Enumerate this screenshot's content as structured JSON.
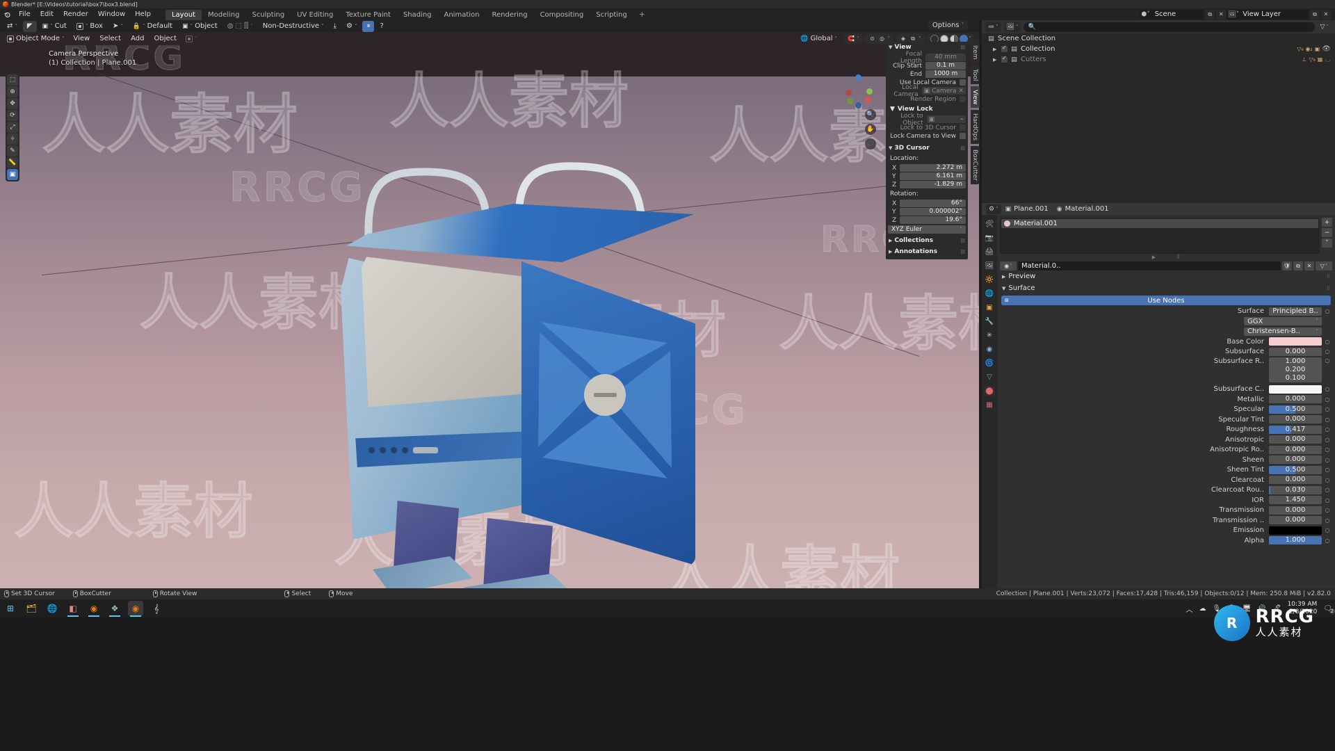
{
  "window": {
    "title": "Blender* [E:\\Videos\\tutorial\\box7\\box3.blend]",
    "icon": "blender-icon"
  },
  "topbar": {
    "logo": "blender-logo",
    "menus": [
      "File",
      "Edit",
      "Render",
      "Window",
      "Help"
    ],
    "workspaces": [
      {
        "label": "Layout",
        "active": true
      },
      {
        "label": "Modeling",
        "active": false
      },
      {
        "label": "Sculpting",
        "active": false
      },
      {
        "label": "UV Editing",
        "active": false
      },
      {
        "label": "Texture Paint",
        "active": false
      },
      {
        "label": "Shading",
        "active": false
      },
      {
        "label": "Animation",
        "active": false
      },
      {
        "label": "Rendering",
        "active": false
      },
      {
        "label": "Compositing",
        "active": false
      },
      {
        "label": "Scripting",
        "active": false
      }
    ],
    "add_workspace": "+",
    "scene_label": "Scene",
    "viewlayer_label": "View Layer"
  },
  "addon_toolbar": {
    "cut_label": "Cut",
    "shape_label": "Box",
    "mode_label": "Default",
    "target_label": "Object",
    "behavior_label": "Non-Destructive"
  },
  "viewport": {
    "mode": "Object Mode",
    "menus": [
      "View",
      "Select",
      "Add",
      "Object"
    ],
    "orientation": "Global",
    "options_label": "Options",
    "overlay_label": "Camera Perspective",
    "overlay_label2": "(1) Collection | Plane.001",
    "gizmo_axes": [
      "X",
      "Y",
      "Z"
    ]
  },
  "npanel": {
    "tabs": [
      {
        "label": "Item",
        "active": false
      },
      {
        "label": "Tool",
        "active": false
      },
      {
        "label": "View",
        "active": true
      },
      {
        "label": "HardOps",
        "active": false
      },
      {
        "label": "BoxCutter",
        "active": false
      }
    ],
    "view_section": {
      "title": "View",
      "rows": [
        {
          "label": "Focal Length",
          "value": "40 mm",
          "dim": true
        },
        {
          "label": "Clip Start",
          "value": "0.1 m",
          "dim": false
        },
        {
          "label": "End",
          "value": "1000 m",
          "dim": false
        }
      ],
      "use_local_camera": "Use Local Camera",
      "local_camera_label": "Local Camera",
      "local_camera_value": "Camera",
      "render_region": "Render Region"
    },
    "view_lock": {
      "title": "View Lock",
      "lock_to_object": "Lock to Object",
      "lock_to_3d_cursor": "Lock to 3D Cursor",
      "lock_camera_to_view": "Lock Camera to View"
    },
    "cursor3d": {
      "title": "3D Cursor",
      "location_label": "Location:",
      "location": [
        {
          "axis": "X",
          "value": "2.272 m"
        },
        {
          "axis": "Y",
          "value": "6.161 m"
        },
        {
          "axis": "Z",
          "value": "-1.829 m"
        }
      ],
      "rotation_label": "Rotation:",
      "rotation": [
        {
          "axis": "X",
          "value": "66°"
        },
        {
          "axis": "Y",
          "value": "0.000002°"
        },
        {
          "axis": "Z",
          "value": "19.6°"
        }
      ],
      "euler_mode": "XYZ Euler"
    },
    "collapsed": [
      {
        "title": "Collections"
      },
      {
        "title": "Annotations"
      }
    ]
  },
  "outliner": {
    "display_mode": "view-layer-icon",
    "filter_icon": "filter-icon",
    "search_placeholder": "",
    "rows": [
      {
        "label": "Scene Collection",
        "indent": 0,
        "icon": "collection-icon",
        "checkbox": false,
        "expandable": false,
        "dim": false,
        "badges": []
      },
      {
        "label": "Collection",
        "indent": 1,
        "icon": "collection-icon",
        "checkbox": true,
        "expandable": true,
        "dim": false,
        "badges": [
          "mesh-9",
          "material-2",
          "object"
        ]
      },
      {
        "label": "Cutters",
        "indent": 1,
        "icon": "collection-icon",
        "checkbox": true,
        "expandable": true,
        "dim": true,
        "badges": [
          "empty",
          "mesh-9",
          "grid"
        ]
      }
    ]
  },
  "properties": {
    "breadcrumb": [
      {
        "label": "Plane.001",
        "icon": "object-icon"
      },
      {
        "label": "Material.001",
        "icon": "material-icon"
      }
    ],
    "tabs": [
      {
        "name": "tool-tab",
        "icon": "🛠",
        "color": "#b9b9b9",
        "active": false
      },
      {
        "name": "render-tab",
        "icon": "📷",
        "color": "#c9c9c9",
        "active": false
      },
      {
        "name": "output-tab",
        "icon": "🖨",
        "color": "#c9c9c9",
        "active": false
      },
      {
        "name": "viewlayer-tab",
        "icon": "🖼",
        "color": "#c9c9c9",
        "active": false
      },
      {
        "name": "scene-tab",
        "icon": "🔆",
        "color": "#d4b37a",
        "active": false
      },
      {
        "name": "world-tab",
        "icon": "🌐",
        "color": "#d96a6a",
        "active": false
      },
      {
        "name": "object-tab",
        "icon": "▣",
        "color": "#e8a33d",
        "active": false
      },
      {
        "name": "modifier-tab",
        "icon": "🔧",
        "color": "#5b9fe0",
        "active": false
      },
      {
        "name": "particles-tab",
        "icon": "✳",
        "color": "#a7c6e8",
        "active": false
      },
      {
        "name": "physics-tab",
        "icon": "◉",
        "color": "#7fb2e8",
        "active": false
      },
      {
        "name": "constraints-tab",
        "icon": "🌀",
        "color": "#7fb2e8",
        "active": false
      },
      {
        "name": "data-tab",
        "icon": "▽",
        "color": "#4fbf8f",
        "active": false
      },
      {
        "name": "material-tab",
        "icon": "⬤",
        "color": "#e06767",
        "active": true
      },
      {
        "name": "texture-tab",
        "icon": "▦",
        "color": "#d16a6a",
        "active": false
      }
    ],
    "material_slot": "Material.001",
    "material_id_name": "Material.0..",
    "preview_label": "Preview",
    "surface_label": "Surface",
    "use_nodes": "Use Nodes",
    "surface_rows": [
      {
        "label": "Surface",
        "value": "Principled B..",
        "type": "enum-right",
        "fill": 0
      },
      {
        "label": "",
        "value": "GGX",
        "type": "enum-full",
        "fill": 0
      },
      {
        "label": "",
        "value": "Christensen-B..",
        "type": "enum-full",
        "fill": 0
      },
      {
        "label": "Base Color",
        "value": "",
        "type": "color",
        "color": "#f6cdcd"
      },
      {
        "label": "Subsurface",
        "value": "0.000",
        "type": "slider",
        "fill": 0
      },
      {
        "label": "Subsurface R..",
        "value": "1.000",
        "type": "stack",
        "stack": [
          "1.000",
          "0.200",
          "0.100"
        ]
      },
      {
        "label": "Subsurface C..",
        "value": "",
        "type": "color",
        "color": "#f7f7f5"
      },
      {
        "label": "Metallic",
        "value": "0.000",
        "type": "slider",
        "fill": 0
      },
      {
        "label": "Specular",
        "value": "0.500",
        "type": "slider",
        "fill": 50
      },
      {
        "label": "Specular Tint",
        "value": "0.000",
        "type": "slider",
        "fill": 0
      },
      {
        "label": "Roughness",
        "value": "0.417",
        "type": "slider",
        "fill": 42
      },
      {
        "label": "Anisotropic",
        "value": "0.000",
        "type": "slider",
        "fill": 0
      },
      {
        "label": "Anisotropic Ro..",
        "value": "0.000",
        "type": "slider",
        "fill": 0
      },
      {
        "label": "Sheen",
        "value": "0.000",
        "type": "slider",
        "fill": 0
      },
      {
        "label": "Sheen Tint",
        "value": "0.500",
        "type": "slider",
        "fill": 50
      },
      {
        "label": "Clearcoat",
        "value": "0.000",
        "type": "slider",
        "fill": 0
      },
      {
        "label": "Clearcoat Rou..",
        "value": "0.030",
        "type": "slider",
        "fill": 3
      },
      {
        "label": "IOR",
        "value": "1.450",
        "type": "slider",
        "fill": 0
      },
      {
        "label": "Transmission",
        "value": "0.000",
        "type": "slider",
        "fill": 0
      },
      {
        "label": "Transmission ..",
        "value": "0.000",
        "type": "slider",
        "fill": 0
      },
      {
        "label": "Emission",
        "value": "",
        "type": "color",
        "color": "#000000"
      },
      {
        "label": "Alpha",
        "value": "1.000",
        "type": "slider",
        "fill": 100
      }
    ]
  },
  "statusbar": {
    "hints": [
      {
        "mouse": "left",
        "label": "Set 3D Cursor"
      },
      {
        "mouse": "left",
        "label": "BoxCutter"
      },
      {
        "mouse": "middle",
        "label": "Rotate View"
      },
      {
        "mouse": "right",
        "label": "Select"
      },
      {
        "mouse": "right",
        "label": "Move"
      }
    ],
    "scene_stats": "Collection | Plane.001 | Verts:23,072 | Faces:17,428 | Tris:46,159 | Objects:0/12 | Mem: 250.8 MiB | v2.82.0"
  },
  "taskbar": {
    "apps": [
      "start-icon",
      "explorer-icon",
      "chrome-icon",
      "app-icon",
      "blender-icon",
      "app2-icon",
      "blender-active-icon",
      "spiral-icon"
    ],
    "tray_icons": [
      "chevron-up-icon",
      "cloud-icon",
      "mic-icon",
      "dropbox-icon",
      "display-icon",
      "volume-icon",
      "pen-icon"
    ],
    "time": "10:39 AM",
    "date": "2/8/2020",
    "notifications": "2"
  },
  "watermark": {
    "brand": "RRCG",
    "cn": "人人素材"
  },
  "colors": {
    "accent_blue": "#4772b3",
    "panel_bg": "#2b2b2b",
    "editor_bg": "#303030",
    "header_bg": "#323232"
  }
}
